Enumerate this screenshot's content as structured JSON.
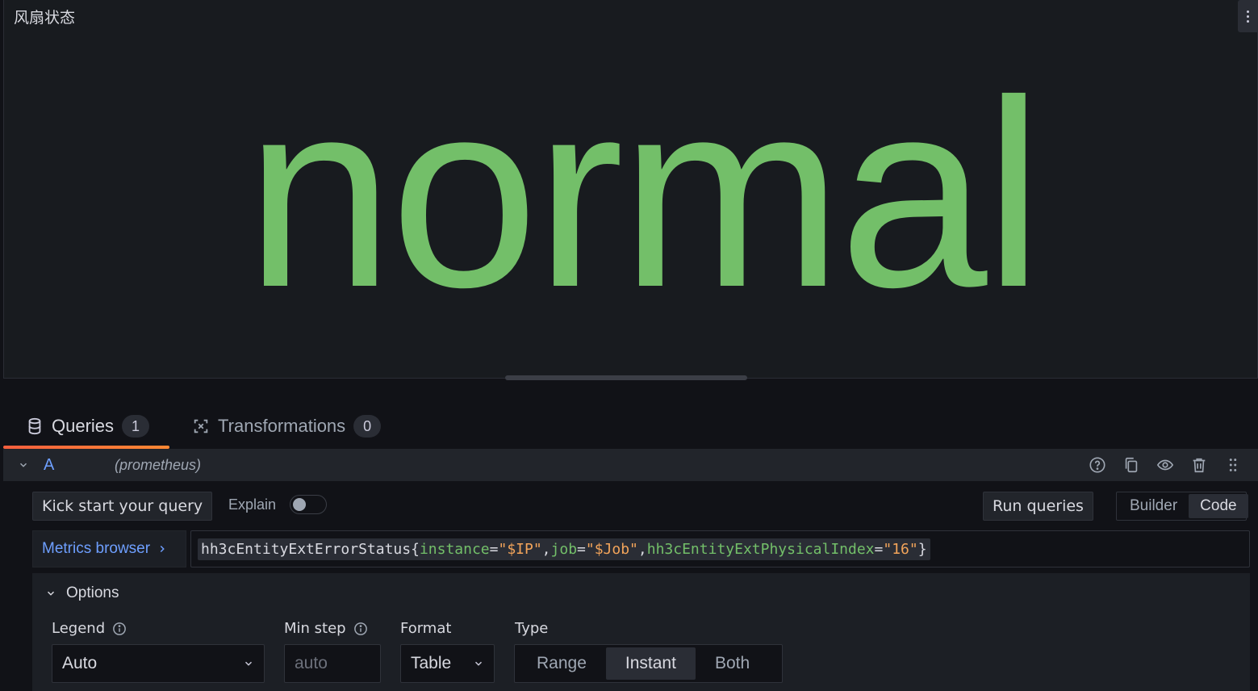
{
  "panel": {
    "title": "风扇状态",
    "stat_value": "normal",
    "stat_color": "#73bf69"
  },
  "tabs": [
    {
      "label": "Queries",
      "count": "1",
      "icon": "database-icon",
      "active": true
    },
    {
      "label": "Transformations",
      "count": "0",
      "icon": "transform-icon",
      "active": false
    }
  ],
  "query": {
    "ref_id": "A",
    "datasource": "(prometheus)",
    "actions": [
      "help-icon",
      "duplicate-icon",
      "eye-icon",
      "trash-icon",
      "drag-handle-icon"
    ],
    "kick_start_label": "Kick start your query",
    "explain_label": "Explain",
    "explain_on": false,
    "run_label": "Run queries",
    "mode_options": [
      "Builder",
      "Code"
    ],
    "mode_selected": "Code",
    "metrics_browser_label": "Metrics browser",
    "expr": {
      "metric": "hh3cEntityExtErrorStatus",
      "open": "{",
      "k1": "instance",
      "v1": "\"$IP\"",
      "k2": "job",
      "v2": "\"$Job\"",
      "k3": "hh3cEntityExtPhysicalIndex",
      "v3": "\"16\"",
      "close": "}",
      "eq": "=",
      "comma": ","
    }
  },
  "options": {
    "title": "Options",
    "legend_label": "Legend",
    "legend_value": "Auto",
    "min_step_label": "Min step",
    "min_step_placeholder": "auto",
    "format_label": "Format",
    "format_value": "Table",
    "type_label": "Type",
    "type_options": [
      "Range",
      "Instant",
      "Both"
    ],
    "type_selected": "Instant"
  },
  "colors": {
    "accent_link": "#6e9fff",
    "tab_underline": "#f55f3e",
    "background": "#111217"
  }
}
